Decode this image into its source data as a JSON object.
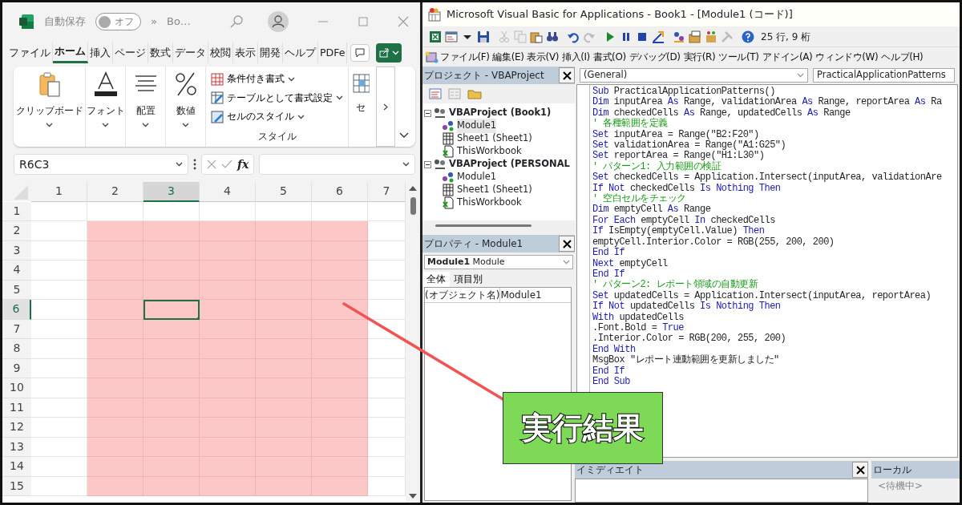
{
  "excel": {
    "title_bar": {
      "autosave_label": "自動保存",
      "autosave_on": false,
      "toggle_text": "オフ",
      "overflow": "»",
      "filename": "Bo…"
    },
    "tabs": [
      {
        "label": "ファイル",
        "selected": false
      },
      {
        "label": "ホーム",
        "selected": true
      },
      {
        "label": "挿入",
        "selected": false
      },
      {
        "label": "ページ",
        "selected": false
      },
      {
        "label": "数式",
        "selected": false
      },
      {
        "label": "データ",
        "selected": false
      },
      {
        "label": "校閲",
        "selected": false
      },
      {
        "label": "表示",
        "selected": false
      },
      {
        "label": "開発",
        "selected": false
      },
      {
        "label": "ヘルプ",
        "selected": false
      },
      {
        "label": "PDFe",
        "selected": false
      }
    ],
    "ribbon": {
      "groups": [
        {
          "kind": "clipboard",
          "label": "クリップボード"
        },
        {
          "kind": "font",
          "label": "フォント"
        },
        {
          "kind": "alignment",
          "label": "配置"
        },
        {
          "kind": "number",
          "label": "数値"
        }
      ],
      "style_group": {
        "label": "スタイル",
        "items": [
          {
            "kind": "conditional",
            "label": "条件付き書式"
          },
          {
            "kind": "table",
            "label": "テーブルとして書式設定"
          },
          {
            "kind": "cellstyle",
            "label": "セルのスタイル"
          }
        ]
      },
      "cells_group_partial": "セ"
    },
    "formula_bar": {
      "name_box": "R6C3",
      "fx": "fx"
    },
    "grid": {
      "columns": [
        {
          "label": "1",
          "selected": false
        },
        {
          "label": "2",
          "selected": false
        },
        {
          "label": "3",
          "selected": true
        },
        {
          "label": "4",
          "selected": false
        },
        {
          "label": "5",
          "selected": false
        },
        {
          "label": "6",
          "selected": false
        },
        {
          "label": "7",
          "selected": false
        }
      ],
      "rows": [
        {
          "label": "1",
          "selected": false,
          "fills": [
            false,
            false,
            false,
            false,
            false,
            false,
            false
          ]
        },
        {
          "label": "2",
          "selected": false,
          "fills": [
            false,
            true,
            true,
            true,
            true,
            true,
            false
          ]
        },
        {
          "label": "3",
          "selected": false,
          "fills": [
            false,
            true,
            true,
            true,
            true,
            true,
            false
          ]
        },
        {
          "label": "4",
          "selected": false,
          "fills": [
            false,
            true,
            true,
            true,
            true,
            true,
            false
          ]
        },
        {
          "label": "5",
          "selected": false,
          "fills": [
            false,
            true,
            true,
            true,
            true,
            true,
            false
          ]
        },
        {
          "label": "6",
          "selected": true,
          "fills": [
            false,
            true,
            true,
            true,
            true,
            true,
            false
          ]
        },
        {
          "label": "7",
          "selected": false,
          "fills": [
            false,
            true,
            true,
            true,
            true,
            true,
            false
          ]
        },
        {
          "label": "8",
          "selected": false,
          "fills": [
            false,
            true,
            true,
            true,
            true,
            true,
            false
          ]
        },
        {
          "label": "9",
          "selected": false,
          "fills": [
            false,
            true,
            true,
            true,
            true,
            true,
            false
          ]
        },
        {
          "label": "10",
          "selected": false,
          "fills": [
            false,
            true,
            true,
            true,
            true,
            true,
            false
          ]
        },
        {
          "label": "11",
          "selected": false,
          "fills": [
            false,
            true,
            true,
            true,
            true,
            true,
            false
          ]
        },
        {
          "label": "12",
          "selected": false,
          "fills": [
            false,
            true,
            true,
            true,
            true,
            true,
            false
          ]
        },
        {
          "label": "13",
          "selected": false,
          "fills": [
            false,
            true,
            true,
            true,
            true,
            true,
            false
          ]
        },
        {
          "label": "14",
          "selected": false,
          "fills": [
            false,
            true,
            true,
            true,
            true,
            true,
            false
          ]
        },
        {
          "label": "15",
          "selected": false,
          "fills": [
            false,
            true,
            true,
            true,
            true,
            true,
            false
          ]
        }
      ]
    }
  },
  "vbe": {
    "title": "Microsoft Visual Basic for Applications - Book1 - [Module1 (コード)]",
    "cursor_position": "25 行, 9 桁",
    "menu": [
      "ファイル(F)",
      "編集(E)",
      "表示(V)",
      "挿入(I)",
      "書式(O)",
      "デバッグ(D)",
      "実行(R)",
      "ツール(T)",
      "アドイン(A)",
      "ウィンドウ(W)",
      "ヘルプ(H)"
    ],
    "project_pane": {
      "title": "プロジェクト - VBAProject",
      "tree": [
        {
          "label": "VBAProject (Book1)",
          "expanded": true,
          "children": [
            {
              "label": "Module1",
              "kind": "module",
              "selected": true
            },
            {
              "label": "Sheet1 (Sheet1)",
              "kind": "sheet",
              "selected": false
            },
            {
              "label": "ThisWorkbook",
              "kind": "workbook",
              "selected": false
            }
          ]
        },
        {
          "label": "VBAProject (PERSONAL",
          "expanded": true,
          "children": [
            {
              "label": "Module1",
              "kind": "module",
              "selected": false
            },
            {
              "label": "Sheet1 (Sheet1)",
              "kind": "sheet",
              "selected": false
            },
            {
              "label": "ThisWorkbook",
              "kind": "workbook",
              "selected": false
            }
          ]
        }
      ]
    },
    "properties_pane": {
      "title": "プロパティ - Module1",
      "object": "**Module1** Module",
      "tabs": [
        {
          "label": "全体",
          "selected": true
        },
        {
          "label": "項目別",
          "selected": false
        }
      ],
      "rows": [
        {
          "name": "(オブジェクト名)",
          "value": "Module1"
        }
      ]
    },
    "code_pane": {
      "object": "(General)",
      "procedure": "PracticalApplicationPatterns",
      "lines": [
        [
          {
            "kind": "kw",
            "text": "Sub"
          },
          {
            "kind": "plain",
            "text": " PracticalApplicationPatterns()"
          }
        ],
        [
          {
            "kind": "kw",
            "text": "Dim"
          },
          {
            "kind": "plain",
            "text": " inputArea "
          },
          {
            "kind": "kw",
            "text": "As"
          },
          {
            "kind": "plain",
            "text": " Range, validationArea "
          },
          {
            "kind": "kw",
            "text": "As"
          },
          {
            "kind": "plain",
            "text": " Range, reportArea "
          },
          {
            "kind": "kw",
            "text": "As"
          },
          {
            "kind": "plain",
            "text": " Ra"
          }
        ],
        [
          {
            "kind": "kw",
            "text": "Dim"
          },
          {
            "kind": "plain",
            "text": " checkedCells "
          },
          {
            "kind": "kw",
            "text": "As"
          },
          {
            "kind": "plain",
            "text": " Range, updatedCells "
          },
          {
            "kind": "kw",
            "text": "As"
          },
          {
            "kind": "plain",
            "text": " Range"
          }
        ],
        [
          {
            "kind": "comment",
            "text": "' 各種範囲を定義"
          }
        ],
        [
          {
            "kind": "kw",
            "text": "Set"
          },
          {
            "kind": "plain",
            "text": " inputArea = Range(\"B2:F20\")"
          }
        ],
        [
          {
            "kind": "kw",
            "text": "Set"
          },
          {
            "kind": "plain",
            "text": " validationArea = Range(\"A1:G25\")"
          }
        ],
        [
          {
            "kind": "kw",
            "text": "Set"
          },
          {
            "kind": "plain",
            "text": " reportArea = Range(\"H1:L30\")"
          }
        ],
        [
          {
            "kind": "comment",
            "text": "' パターン1: 入力範囲の検証"
          }
        ],
        [
          {
            "kind": "kw",
            "text": "Set"
          },
          {
            "kind": "plain",
            "text": " checkedCells = Application.Intersect(inputArea, validationAre"
          }
        ],
        [
          {
            "kind": "kw",
            "text": "If Not"
          },
          {
            "kind": "plain",
            "text": " checkedCells "
          },
          {
            "kind": "kw",
            "text": "Is Nothing Then"
          }
        ],
        [
          {
            "kind": "comment",
            "text": "' 空白セルをチェック"
          }
        ],
        [
          {
            "kind": "kw",
            "text": "Dim"
          },
          {
            "kind": "plain",
            "text": " emptyCell "
          },
          {
            "kind": "kw",
            "text": "As"
          },
          {
            "kind": "plain",
            "text": " Range"
          }
        ],
        [
          {
            "kind": "kw",
            "text": "For Each"
          },
          {
            "kind": "plain",
            "text": " emptyCell "
          },
          {
            "kind": "kw",
            "text": "In"
          },
          {
            "kind": "plain",
            "text": " checkedCells"
          }
        ],
        [
          {
            "kind": "kw",
            "text": "If"
          },
          {
            "kind": "plain",
            "text": " IsEmpty(emptyCell.Value) "
          },
          {
            "kind": "kw",
            "text": "Then"
          }
        ],
        [
          {
            "kind": "plain",
            "text": "emptyCell.Interior.Color = RGB(255, 200, 200)"
          }
        ],
        [
          {
            "kind": "kw",
            "text": "End If"
          }
        ],
        [
          {
            "kind": "kw",
            "text": "Next"
          },
          {
            "kind": "plain",
            "text": " emptyCell"
          }
        ],
        [
          {
            "kind": "kw",
            "text": "End If"
          }
        ],
        [
          {
            "kind": "comment",
            "text": "' パターン2: レポート領域の自動更新"
          }
        ],
        [
          {
            "kind": "kw",
            "text": "Set"
          },
          {
            "kind": "plain",
            "text": " updatedCells = Application.Intersect(inputArea, reportArea)"
          }
        ],
        [
          {
            "kind": "kw",
            "text": "If Not"
          },
          {
            "kind": "plain",
            "text": " updatedCells "
          },
          {
            "kind": "kw",
            "text": "Is Nothing Then"
          }
        ],
        [
          {
            "kind": "kw",
            "text": "With"
          },
          {
            "kind": "plain",
            "text": " updatedCells"
          }
        ],
        [
          {
            "kind": "plain",
            "text": ".Font.Bold = "
          },
          {
            "kind": "kw",
            "text": "True"
          }
        ],
        [
          {
            "kind": "plain",
            "text": ".Interior.Color = RGB(200, 255, 200)"
          }
        ],
        [
          {
            "kind": "kw",
            "text": "End With"
          }
        ],
        [
          {
            "kind": "plain",
            "text": "MsgBox \"レポート連動範囲を更新しました\""
          }
        ],
        [
          {
            "kind": "kw",
            "text": "End If"
          }
        ],
        [
          {
            "kind": "kw",
            "text": "End Sub"
          }
        ]
      ]
    },
    "immediate_pane": {
      "title": "イミディエイト"
    },
    "locals_pane": {
      "title": "ローカル",
      "status": "<待機中>"
    }
  },
  "callout": {
    "text": "実行結果"
  }
}
